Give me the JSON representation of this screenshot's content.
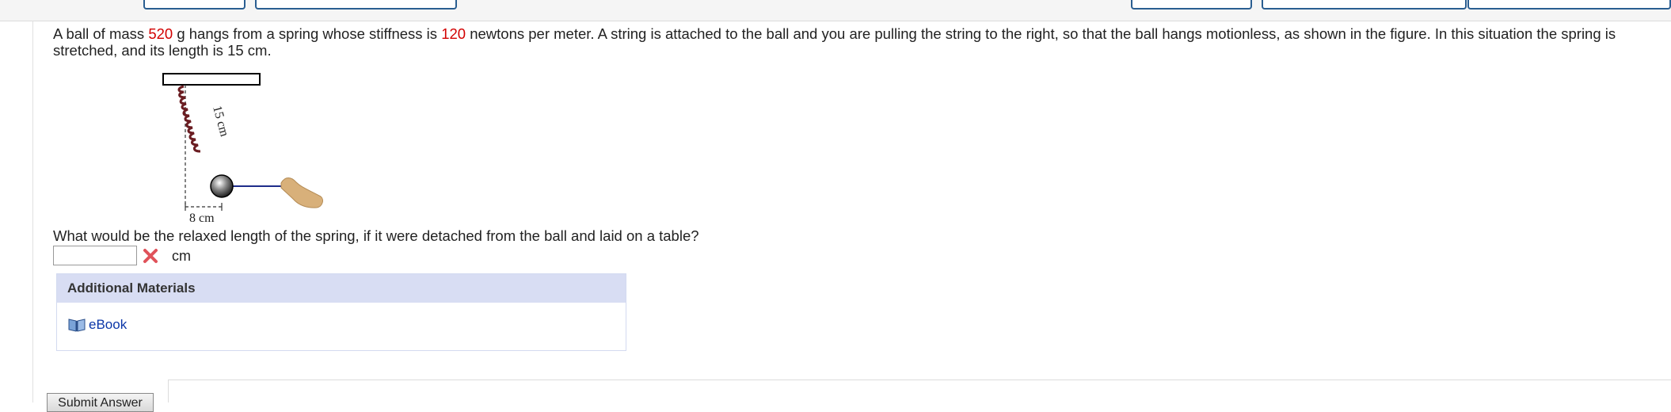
{
  "question": {
    "part1": "A ball of mass ",
    "mass": "520",
    "part2": " g hangs from a spring whose stiffness is ",
    "stiffness": "120",
    "part3": " newtons per meter. A string is attached to the ball and you are pulling the string to the right, so that the ball hangs motionless, as shown in the figure. In this situation the spring is stretched, and its length is 15 cm."
  },
  "figure": {
    "length_label": "15 cm",
    "horizontal_label": "8 cm"
  },
  "prompt": "What would be the relaxed length of the spring, if it were detached from the ball and laid on a table?",
  "answer": {
    "value": "",
    "unit": "cm",
    "status": "incorrect"
  },
  "additional_materials": {
    "title": "Additional Materials",
    "ebook_label": "eBook"
  },
  "submit": {
    "label": "Submit Answer"
  }
}
